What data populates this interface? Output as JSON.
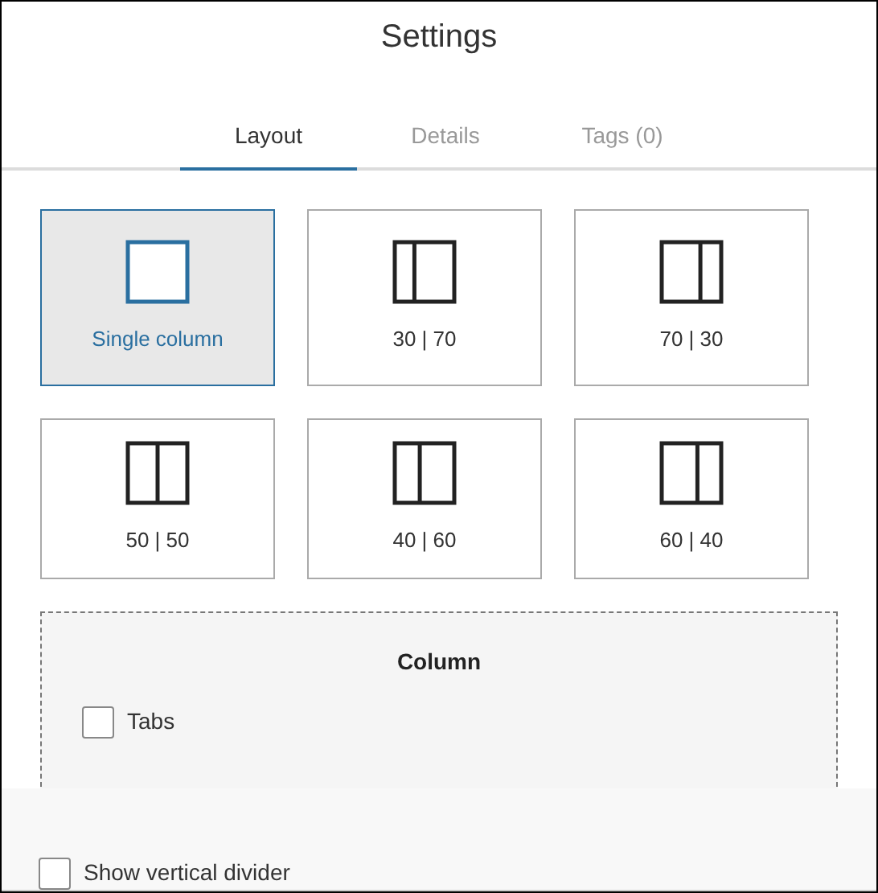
{
  "window": {
    "title": "Settings"
  },
  "tabs": [
    {
      "label": "Layout",
      "selected": true
    },
    {
      "label": "Details",
      "selected": false
    },
    {
      "label": "Tags (0)",
      "selected": false
    }
  ],
  "layouts": [
    {
      "label": "Single column",
      "kind": "single",
      "selected": true
    },
    {
      "label": "30 | 70",
      "kind": "narrowleft",
      "selected": false
    },
    {
      "label": "70 | 30",
      "kind": "narrowright",
      "selected": false
    },
    {
      "label": "50 | 50",
      "kind": "even",
      "selected": false
    },
    {
      "label": "40 | 60",
      "kind": "leftsmaller",
      "selected": false
    },
    {
      "label": "60 | 40",
      "kind": "rightsmaller",
      "selected": false
    }
  ],
  "column_panel": {
    "title": "Column",
    "options": [
      {
        "label": "Tabs",
        "checked": false
      }
    ]
  },
  "footer_options": [
    {
      "label": "Show vertical divider",
      "checked": false
    }
  ]
}
